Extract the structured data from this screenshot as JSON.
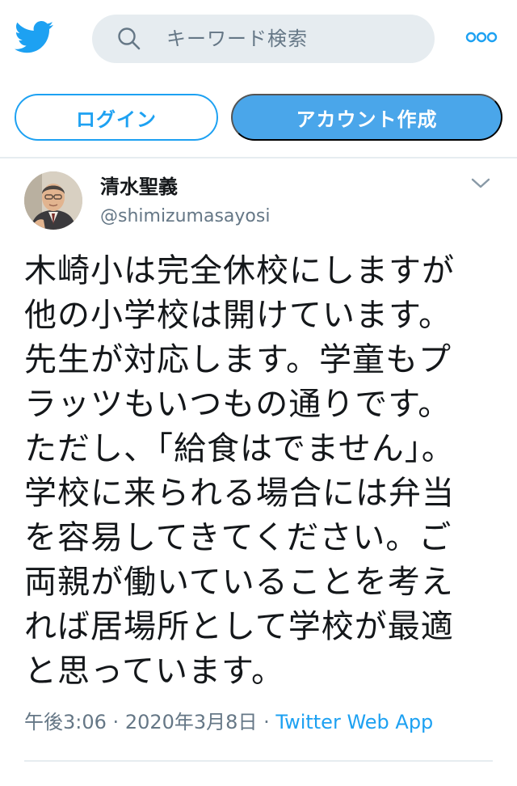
{
  "header": {
    "logo_icon": "twitter-bird-icon",
    "search": {
      "placeholder": "キーワード検索",
      "icon": "search-icon"
    },
    "more_icon": "more-dots-icon"
  },
  "auth": {
    "login_label": "ログイン",
    "signup_label": "アカウント作成"
  },
  "tweet": {
    "author": {
      "display_name": "清水聖義",
      "handle": "@shimizumasayosi"
    },
    "text": "木崎小は完全休校にしますが他の小学校は開けています。先生が対応します。学童もプラッツもいつもの通りです。ただし、「給食はでません」。学校に来られる場合には弁当を容易してきてください。ご両親が働いていることを考えれば居場所として学校が最適と思っています。",
    "time": "午後3:06",
    "separator": "·",
    "date": "2020年3月8日",
    "source": "Twitter Web App"
  },
  "colors": {
    "brand_blue": "#1da1f2",
    "signup_bg": "#4aa6ea",
    "search_bg": "#e6ecf0",
    "muted_text": "#657786"
  }
}
